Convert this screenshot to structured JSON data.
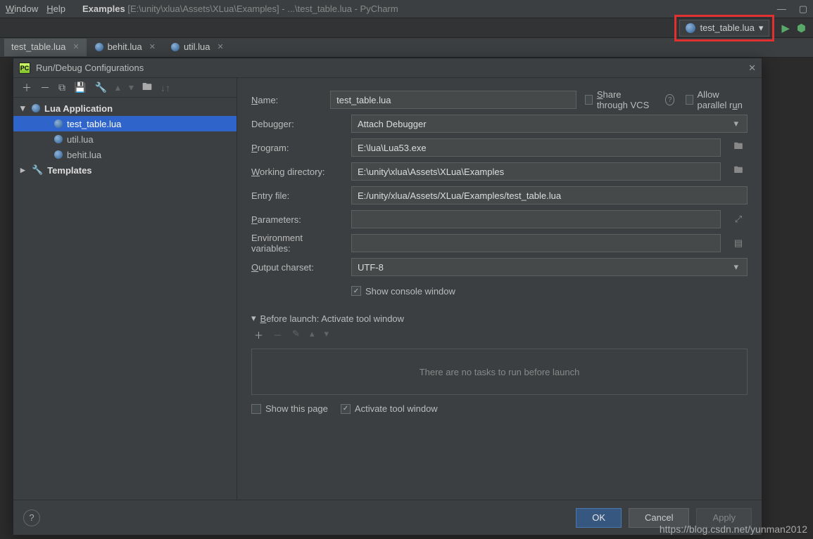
{
  "menu": {
    "window": "Window",
    "help": "Help"
  },
  "titlebar": {
    "project": "Examples",
    "path": "[E:\\unity\\xlua\\Assets\\XLua\\Examples] - ...\\test_table.lua - PyCharm"
  },
  "run_selector": {
    "label": "test_table.lua"
  },
  "tabs": [
    {
      "name": "test_table.lua",
      "active": true
    },
    {
      "name": "behit.lua",
      "active": false
    },
    {
      "name": "util.lua",
      "active": false
    }
  ],
  "dialog": {
    "title": "Run/Debug Configurations",
    "tree": {
      "group": "Lua Application",
      "items": [
        "test_table.lua",
        "util.lua",
        "behit.lua"
      ],
      "templates": "Templates"
    },
    "form": {
      "name_label": "Name:",
      "name_value": "test_table.lua",
      "share_vcs": "Share through VCS",
      "allow_parallel": "Allow parallel run",
      "debugger_label": "Debugger:",
      "debugger_value": "Attach Debugger",
      "program_label": "Program:",
      "program_value": "E:\\lua\\Lua53.exe",
      "wd_label": "Working directory:",
      "wd_value": "E:\\unity\\xlua\\Assets\\XLua\\Examples",
      "entry_label": "Entry file:",
      "entry_value": "E:/unity/xlua/Assets/XLua/Examples/test_table.lua",
      "params_label": "Parameters:",
      "params_value": "",
      "env_label": "Environment variables:",
      "env_value": "",
      "charset_label": "Output charset:",
      "charset_value": "UTF-8",
      "show_console": "Show console window",
      "before_launch": "Before launch: Activate tool window",
      "no_tasks": "There are no tasks to run before launch",
      "show_page": "Show this page",
      "activate_tool": "Activate tool window"
    },
    "buttons": {
      "ok": "OK",
      "cancel": "Cancel",
      "apply": "Apply"
    }
  },
  "watermark": "https://blog.csdn.net/yunman2012"
}
